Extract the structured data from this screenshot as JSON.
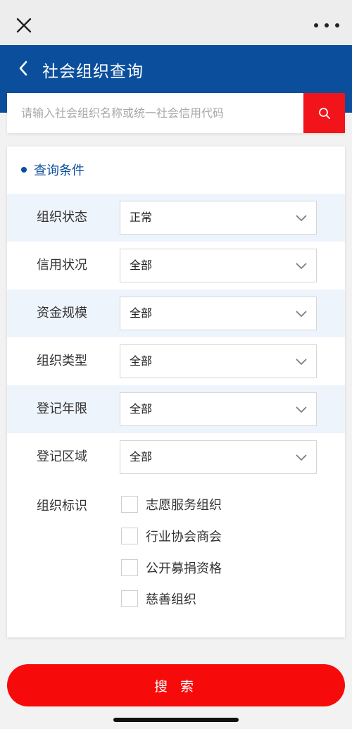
{
  "window": {
    "close_icon": "close-icon",
    "more_icon": "more-dots-icon"
  },
  "header": {
    "title": "社会组织查询",
    "back_icon": "chevron-left-icon",
    "bg_color": "#0b4f9c"
  },
  "search": {
    "placeholder": "请输入社会组织名称或统一社会信用代码",
    "value": "",
    "button_icon": "search-icon",
    "button_color": "#f1141b"
  },
  "conditions": {
    "title": "查询条件",
    "fields": [
      {
        "label": "组织状态",
        "value": "正常"
      },
      {
        "label": "信用状况",
        "value": "全部"
      },
      {
        "label": "资金规模",
        "value": "全部"
      },
      {
        "label": "组织类型",
        "value": "全部"
      },
      {
        "label": "登记年限",
        "value": "全部"
      },
      {
        "label": "登记区域",
        "value": "全部"
      }
    ],
    "flags": {
      "label": "组织标识",
      "options": [
        {
          "label": "志愿服务组织",
          "checked": false
        },
        {
          "label": "行业协会商会",
          "checked": false
        },
        {
          "label": "公开募捐资格",
          "checked": false
        },
        {
          "label": "慈善组织",
          "checked": false
        }
      ]
    }
  },
  "submit": {
    "label": "搜 索",
    "color": "#f70a0a"
  }
}
